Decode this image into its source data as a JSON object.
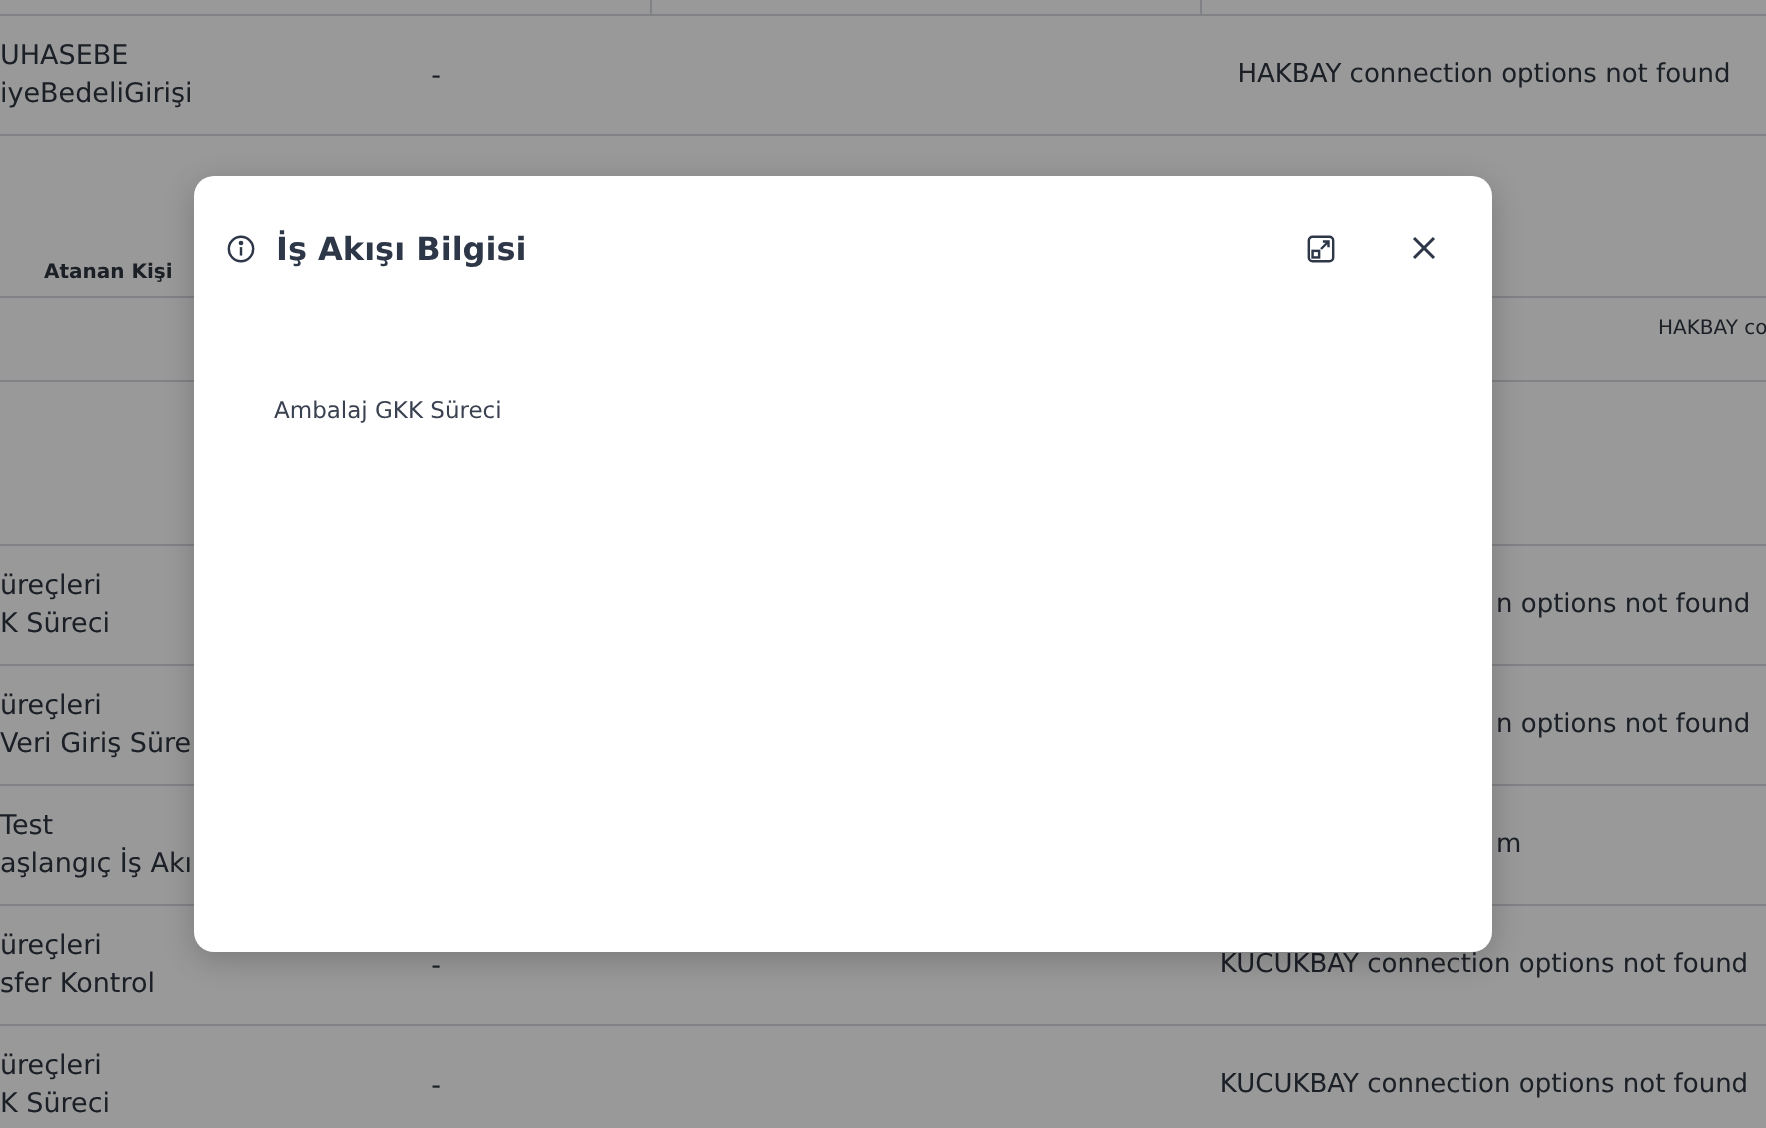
{
  "table": {
    "rows": [
      {
        "kind": "stub"
      },
      {
        "kind": "data",
        "label_lines": [
          "UHASEBE",
          "iyeBedeliGirişi"
        ],
        "value": "-",
        "message": {
          "text": "HAKBAY connection options not found",
          "kind": "full"
        }
      },
      {
        "kind": "group",
        "label_lines": [
          "Atanan Kişi"
        ]
      },
      {
        "kind": "note",
        "message": {
          "text": "HAKBAY co",
          "kind": "edge"
        }
      },
      {
        "kind": "blank"
      },
      {
        "kind": "data",
        "label_lines": [
          "üreçleri",
          "K Süreci"
        ],
        "message": {
          "text": "n options not found",
          "kind": "partial"
        }
      },
      {
        "kind": "data",
        "label_lines": [
          "üreçleri",
          "Veri Giriş Süre"
        ],
        "message": {
          "text": "n options not found",
          "kind": "partial"
        }
      },
      {
        "kind": "data",
        "label_lines": [
          "Test",
          "aşlangıç İş Akı"
        ],
        "message": {
          "text": "m",
          "kind": "partial"
        }
      },
      {
        "kind": "data",
        "label_lines": [
          "üreçleri",
          "sfer Kontrol"
        ],
        "value": "-",
        "message": {
          "text": "KUCUKBAY connection options not found",
          "kind": "full"
        }
      },
      {
        "kind": "data",
        "label_lines": [
          "üreçleri",
          "K Süreci"
        ],
        "value": "-",
        "message": {
          "text": "KUCUKBAY connection options not found",
          "kind": "full"
        }
      }
    ]
  },
  "dialog": {
    "title": "İş Akışı Bilgisi",
    "content": "Ambalaj GKK Süreci"
  }
}
